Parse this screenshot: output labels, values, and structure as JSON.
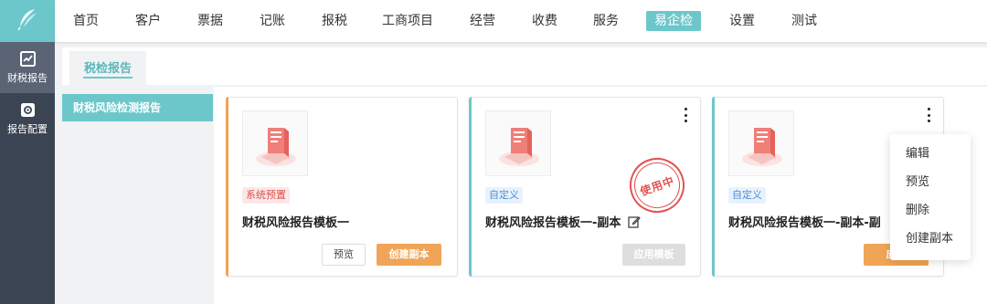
{
  "sidebar": {
    "items": [
      {
        "label": "财税报告",
        "icon": "report-chart-icon",
        "active": true
      },
      {
        "label": "报告配置",
        "icon": "gear-icon",
        "active": false
      }
    ]
  },
  "nav": {
    "items": [
      "首页",
      "客户",
      "票据",
      "记账",
      "报税",
      "工商项目",
      "经营",
      "收费",
      "服务",
      "易企检",
      "设置",
      "测试"
    ],
    "active": "易企检"
  },
  "tabs": [
    {
      "label": "税检报告"
    }
  ],
  "side_menu": {
    "items": [
      {
        "label": "财税风险检测报告",
        "active": true
      }
    ]
  },
  "cards": [
    {
      "tag": "系统预置",
      "title": "财税风险报告模板一",
      "buttons": [
        "预览",
        "创建副本"
      ],
      "accent": "#f0a556"
    },
    {
      "tag": "自定义",
      "title": "财税风险报告模板一-副本",
      "stamp": "使用中",
      "buttons": [
        "应用模板"
      ],
      "accent": "#6cc7cb"
    },
    {
      "tag": "自定义",
      "title": "财税风险报告模板一-副本-副",
      "buttons": [
        "应用"
      ],
      "accent": "#6cc7cb"
    }
  ],
  "dropdown": {
    "items": [
      "编辑",
      "预览",
      "删除",
      "创建副本"
    ]
  },
  "colors": {
    "brand": "#6cc7cb",
    "rail": "#3a4453",
    "orange": "#f0a556",
    "red": "#e05350"
  }
}
